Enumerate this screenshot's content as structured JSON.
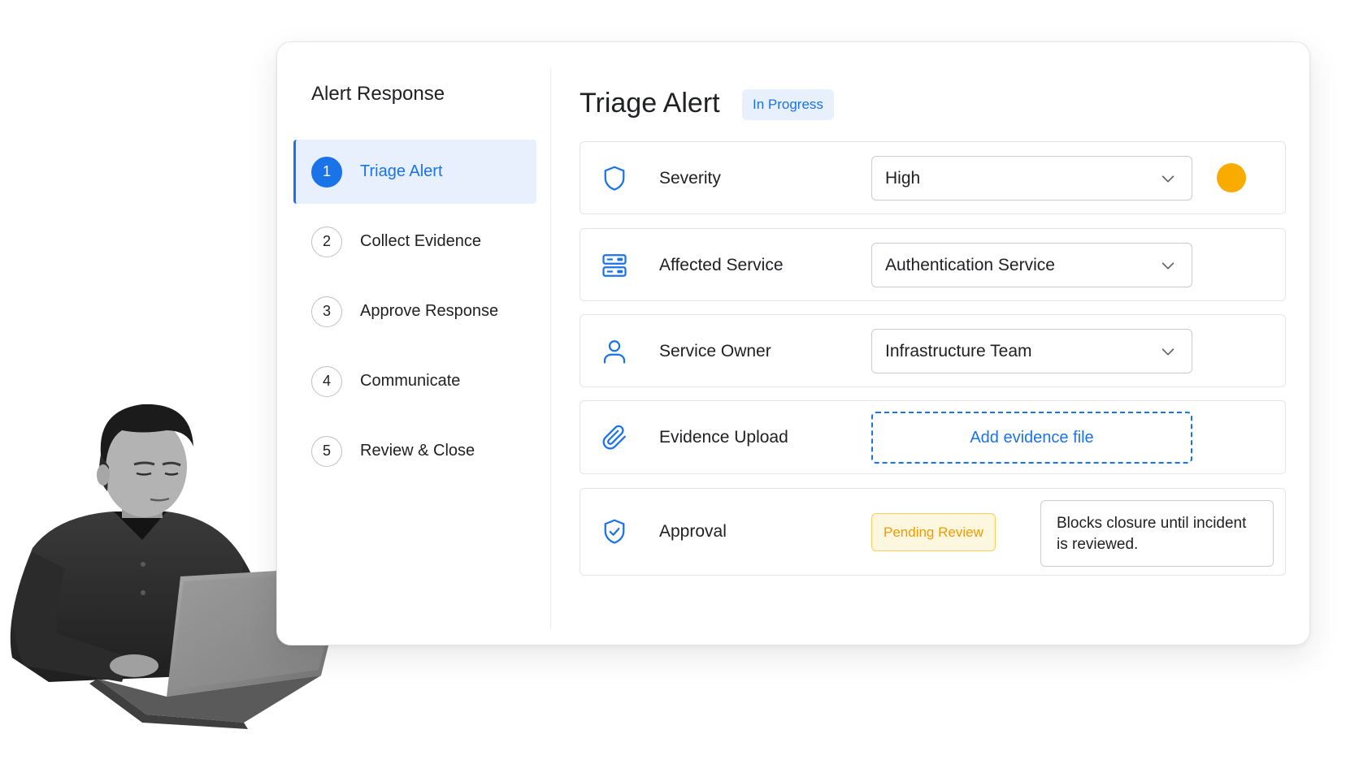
{
  "sidebar": {
    "title": "Alert Response",
    "steps": [
      {
        "number": "1",
        "label": "Triage Alert",
        "active": true
      },
      {
        "number": "2",
        "label": "Collect Evidence",
        "active": false
      },
      {
        "number": "3",
        "label": "Approve Response",
        "active": false
      },
      {
        "number": "4",
        "label": "Communicate",
        "active": false
      },
      {
        "number": "5",
        "label": "Review & Close",
        "active": false
      }
    ]
  },
  "main": {
    "title": "Triage Alert",
    "status": "In Progress",
    "fields": {
      "severity": {
        "label": "Severity",
        "value": "High",
        "icon": "shield-icon",
        "indicator_color": "#f9ab00"
      },
      "affected_service": {
        "label": "Affected Service",
        "value": "Authentication Service",
        "icon": "server-icon"
      },
      "service_owner": {
        "label": "Service Owner",
        "value": "Infrastructure Team",
        "icon": "person-icon"
      },
      "evidence_upload": {
        "label": "Evidence Upload",
        "action": "Add evidence file",
        "icon": "paperclip-icon"
      },
      "approval": {
        "label": "Approval",
        "status": "Pending Review",
        "note": "Blocks closure until incident is reviewed.",
        "icon": "shield-check-icon"
      }
    }
  },
  "colors": {
    "accent": "#1a73e8",
    "accent_bg": "#e8f0fe",
    "warning": "#f9ab00",
    "pending_text": "#f29900",
    "pending_bg": "#fef7e0"
  }
}
